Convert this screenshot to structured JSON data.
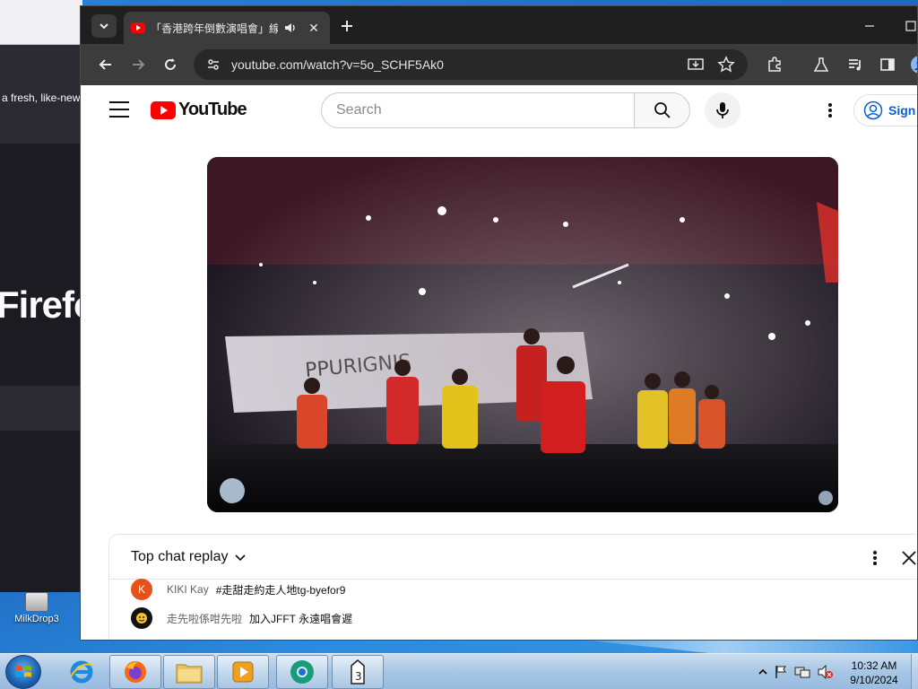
{
  "background_window": {
    "banner_text": "a fresh, like-new",
    "brand_text": "Firefo"
  },
  "desktop": {
    "icon_label": "MilkDrop3"
  },
  "browser": {
    "tab": {
      "title": "「香港跨年倒數演唱會」線上",
      "close_glyph": "✕"
    },
    "newtab_glyph": "+",
    "address": {
      "url": "youtube.com/watch?v=5o_SCHF5Ak0"
    }
  },
  "youtube": {
    "logo_text": "YouTube",
    "search_placeholder": "Search",
    "signin_label": "Sign in",
    "chat": {
      "title": "Top chat replay",
      "messages": [
        {
          "avatar_letter": "K",
          "avatar_color": "#e8501a",
          "author": "KIKI Kay",
          "text": "#走甜走約走人地tg-byefor9"
        },
        {
          "avatar_letter": "",
          "avatar_color": "#111111",
          "author": "走先啦係咁先啦",
          "text": "加入JFFT 永遠唱會遲"
        }
      ]
    }
  },
  "taskbar": {
    "clock_time": "10:32 AM",
    "clock_date": "9/10/2024",
    "apps": [
      "internet-explorer",
      "firefox",
      "file-explorer",
      "media-player",
      "chrome",
      "milkdrop3"
    ]
  },
  "colors": {
    "youtube_red": "#ff0000",
    "chrome_dark": "#3c3c3c",
    "link_blue": "#065fd4"
  }
}
